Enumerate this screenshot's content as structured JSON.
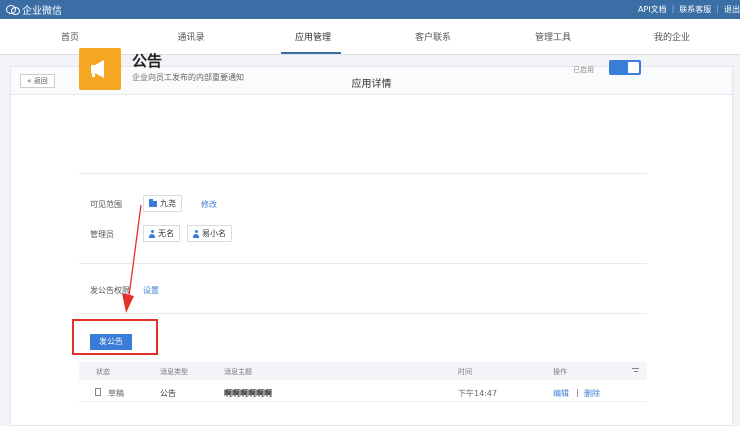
{
  "header": {
    "brand": "企业微信",
    "links": [
      "API文档",
      "联系客服",
      "退出"
    ]
  },
  "nav": {
    "items": [
      "首页",
      "通讯录",
      "应用管理",
      "客户联系",
      "管理工具",
      "我的企业"
    ],
    "active": "应用管理"
  },
  "panel": {
    "back_label": "« 返回",
    "title": "应用详情"
  },
  "app": {
    "icon": "megaphone-icon",
    "name": "公告",
    "description": "企业向员工发布的内部重要通知",
    "status_label": "已启用",
    "enabled": true
  },
  "visibility": {
    "label": "可见范围",
    "department": "九尧",
    "edit_label": "修改"
  },
  "admins": {
    "label": "管理员",
    "members": [
      "无名",
      "易小名"
    ]
  },
  "permission": {
    "label": "发公告权限",
    "setting_link": "设置"
  },
  "publish_button": "发公告",
  "table": {
    "columns": [
      "状态",
      "消息类型",
      "消息主题",
      "时间",
      "操作"
    ],
    "rows": [
      {
        "status": "草稿",
        "type": "公告",
        "subject": "啊啊啊啊啊啊",
        "time": "下午14:47",
        "actions": [
          "编辑",
          "删除"
        ]
      }
    ]
  },
  "colors": {
    "brand": "#3a6ea5",
    "accent": "#3a7dd8",
    "app_icon": "#f5a623",
    "highlight": "#e3322a"
  }
}
